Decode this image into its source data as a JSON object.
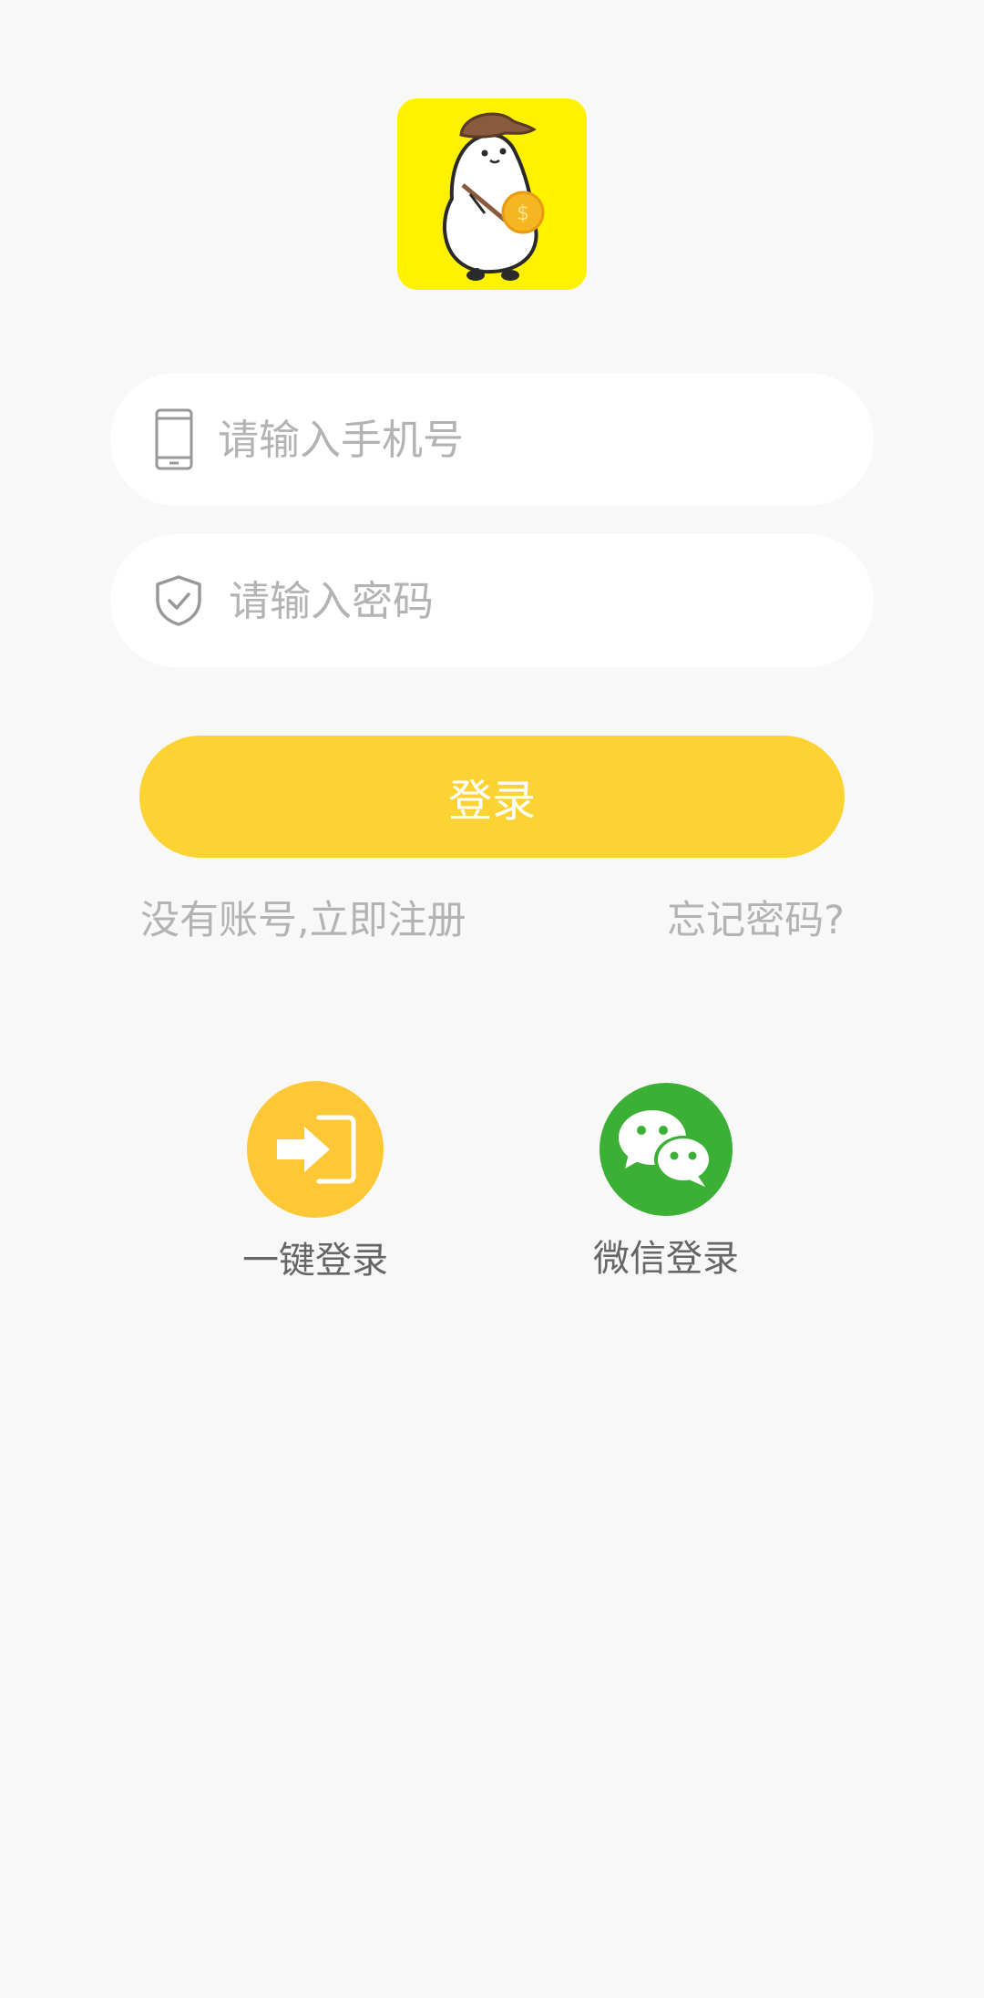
{
  "logo": {
    "name": "app-logo-mascot",
    "background": "#fff200"
  },
  "phone_field": {
    "icon": "phone-icon",
    "placeholder": "请输入手机号",
    "value": ""
  },
  "password_field": {
    "icon": "shield-check-icon",
    "placeholder": "请输入密码",
    "value": ""
  },
  "login_button": {
    "label": "登录",
    "color": "#fdd334"
  },
  "links": {
    "register": "没有账号,立即注册",
    "forgot": "忘记密码?"
  },
  "alt_logins": {
    "quick": {
      "icon": "sign-in-arrow-icon",
      "label": "一键登录",
      "color": "#fec735"
    },
    "wechat": {
      "icon": "wechat-icon",
      "label": "微信登录",
      "color": "#3cb035"
    }
  }
}
